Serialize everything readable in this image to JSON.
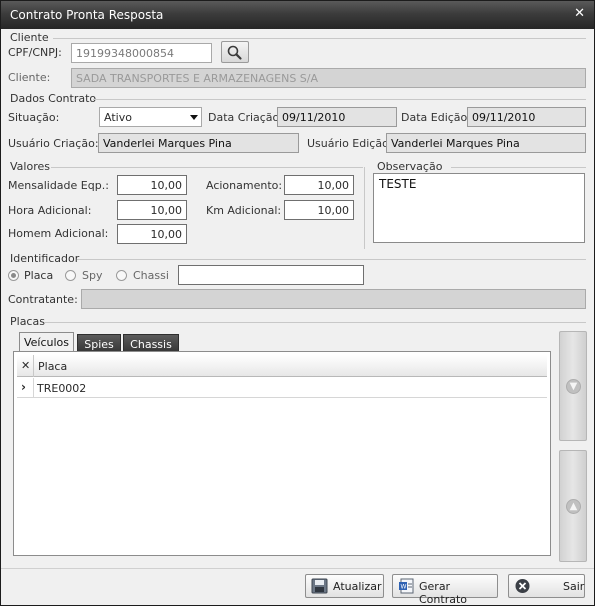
{
  "window": {
    "title": "Contrato Pronta Resposta"
  },
  "cliente": {
    "group_label": "Cliente",
    "cpf_label": "CPF/CNPJ:",
    "cpf_value": "19199348000854",
    "cliente_label": "Cliente:",
    "cliente_value": "SADA TRANSPORTES E ARMAZENAGENS S/A"
  },
  "dados": {
    "group_label": "Dados Contrato",
    "situacao_label": "Situação:",
    "situacao_value": "Ativo",
    "data_criacao_label": "Data Criação:",
    "data_criacao_value": "09/11/2010",
    "data_edicao_label": "Data Edição:",
    "data_edicao_value": "09/11/2010",
    "usuario_criacao_label": "Usuário Criação:",
    "usuario_criacao_value": "Vanderlei Marques Pina",
    "usuario_edicao_label": "Usuário Edição:",
    "usuario_edicao_value": "Vanderlei Marques Pina"
  },
  "valores": {
    "group_label": "Valores",
    "mensalidade_label": "Mensalidade Eqp.:",
    "mensalidade_value": "10,00",
    "acionamento_label": "Acionamento:",
    "acionamento_value": "10,00",
    "hora_adicional_label": "Hora Adicional:",
    "hora_adicional_value": "10,00",
    "km_adicional_label": "Km Adicional:",
    "km_adicional_value": "10,00",
    "homem_adicional_label": "Homem Adicional:",
    "homem_adicional_value": "10,00"
  },
  "observacao": {
    "group_label": "Observação",
    "value": "TESTE"
  },
  "identificador": {
    "group_label": "Identificador",
    "options": [
      "Placa",
      "Spy",
      "Chassi"
    ],
    "selected": "Placa",
    "value": "",
    "contratante_label": "Contratante:",
    "contratante_value": ""
  },
  "placas": {
    "group_label": "Placas",
    "tabs": [
      "Veículos",
      "Spies",
      "Chassis"
    ],
    "active_tab": "Veículos",
    "column_header": "Placa",
    "rows": [
      "TRE0002"
    ]
  },
  "buttons": {
    "atualizar": "Atualizar",
    "gerar_contrato": "Gerar Contrato",
    "sair": "Sair"
  },
  "icons": {
    "close": "close-icon",
    "search": "search-icon",
    "row_pointer": "row-pointer-icon",
    "remove_column": "remove-column-icon",
    "scroll_down": "scroll-down-icon",
    "scroll_up": "scroll-up-icon",
    "save": "save-icon",
    "document": "document-icon",
    "exit": "exit-icon"
  },
  "colors": {
    "titlebar": "#3c3c3c",
    "window_bg": "#f0f0f0",
    "readonly_field": "#e3e3e3",
    "disabled_field": "#d4d4d4",
    "tab_inactive": "#454545"
  }
}
